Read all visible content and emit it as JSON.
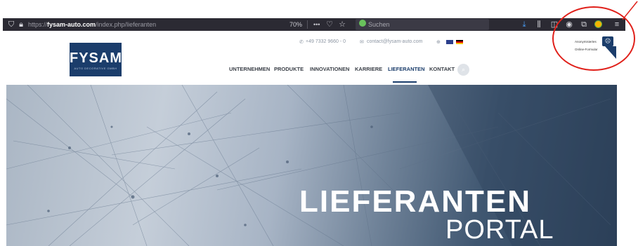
{
  "browser": {
    "url_prefix": "https://",
    "url_domain": "fysam-auto.com",
    "url_path": "/index.php/lieferanten",
    "zoom": "70%",
    "more_icon": "•••",
    "search_placeholder": "Suchen",
    "icons": [
      "shield-icon",
      "lock-icon",
      "pocket-icon",
      "bookmark-star-icon",
      "download-icon",
      "library-icon",
      "sidebar-icon",
      "account-icon",
      "screenshot-icon",
      "extension-icon",
      "menu-icon"
    ]
  },
  "header": {
    "logo_brand": "FYSAM",
    "logo_tagline": "AUTO DECORATIVE GMBH",
    "phone": "+49 7332 9660 - 0",
    "email": "contact@fysam-auto.com",
    "nav": [
      {
        "label": "UNTERNEHMEN"
      },
      {
        "label": "PRODUKTE"
      },
      {
        "label": "INNOVATIONEN"
      },
      {
        "label": "KARRIERE"
      },
      {
        "label": "LIEFERANTEN",
        "active": true
      },
      {
        "label": "KONTAKT"
      }
    ]
  },
  "hero": {
    "title_line1": "LIEFERANTEN",
    "title_line2": "PORTAL"
  },
  "widget": {
    "line1": "Anonymisiertes",
    "line2": "Online-Formular"
  },
  "colors": {
    "brand": "#1b3d6b",
    "annotation": "#e0201a",
    "browser_dark": "#2b2a33"
  }
}
